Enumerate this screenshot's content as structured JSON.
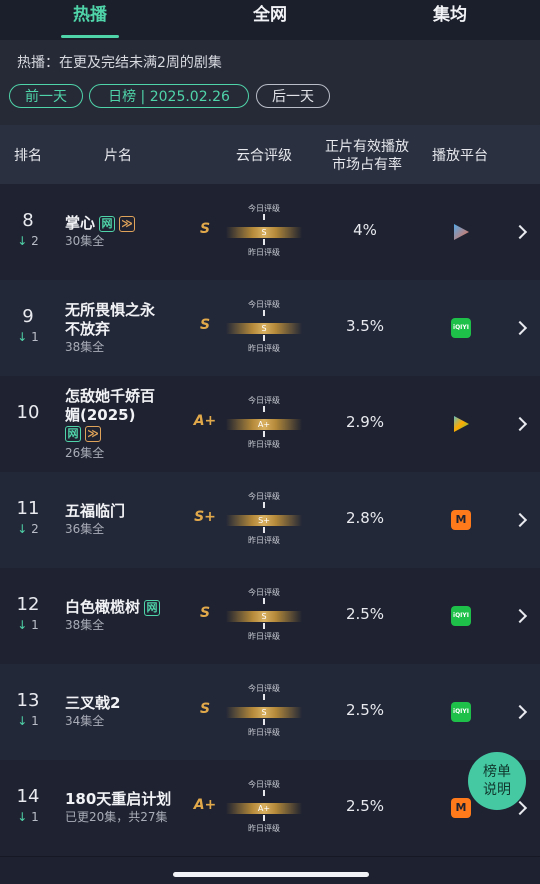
{
  "tabs": [
    "热播",
    "全网",
    "集均"
  ],
  "info": {
    "description": "热播：在更及完结未满2周的剧集",
    "prev_day": "前一天",
    "date_pill": "日榜 | 2025.02.26",
    "next_day": "后一天"
  },
  "header": {
    "rank": "排名",
    "title": "片名",
    "rating": "云合评级",
    "share_l1": "正片有效播放",
    "share_l2": "市场占有率",
    "platform": "播放平台"
  },
  "rating_labels": {
    "today": "今日评级",
    "yesterday": "昨日评级"
  },
  "badges": {
    "net": "网",
    "ff": "≫"
  },
  "rows": [
    {
      "rank": "8",
      "change": "2",
      "title_lines": [
        "掌心"
      ],
      "badges": [
        "net",
        "ff"
      ],
      "episodes": "30集全",
      "grade": "S",
      "share": "4%",
      "platform": "youku-icon"
    },
    {
      "rank": "9",
      "change": "1",
      "title_lines": [
        "无所畏惧之永",
        "不放弃"
      ],
      "badges": [],
      "episodes": "38集全",
      "grade": "S",
      "share": "3.5%",
      "platform": "iqiyi-icon"
    },
    {
      "rank": "10",
      "change": "",
      "title_lines": [
        "怎敌她千娇百",
        "媚(2025)"
      ],
      "badges": [
        "net",
        "ff"
      ],
      "episodes": "26集全",
      "grade": "A+",
      "share": "2.9%",
      "platform": "tencent-video-icon"
    },
    {
      "rank": "11",
      "change": "2",
      "title_lines": [
        "五福临门"
      ],
      "badges": [],
      "episodes": "36集全",
      "grade": "S+",
      "share": "2.8%",
      "platform": "mango-tv-icon"
    },
    {
      "rank": "12",
      "change": "1",
      "title_lines": [
        "白色橄榄树"
      ],
      "badges": [
        "net"
      ],
      "episodes": "38集全",
      "grade": "S",
      "share": "2.5%",
      "platform": "iqiyi-icon"
    },
    {
      "rank": "13",
      "change": "1",
      "title_lines": [
        "三叉戟2"
      ],
      "badges": [],
      "episodes": "34集全",
      "grade": "S",
      "share": "2.5%",
      "platform": "iqiyi-icon"
    },
    {
      "rank": "14",
      "change": "1",
      "title_lines": [
        "180天重启计划"
      ],
      "badges": [],
      "episodes": "已更20集，共27集",
      "grade": "A+",
      "share": "2.5%",
      "platform": "mango-tv-icon"
    }
  ],
  "fab": {
    "line1": "榜单",
    "line2": "说明"
  },
  "colors": {
    "accent": "#4fd3a8",
    "grade": "#e2a94b",
    "background": "#1e2230"
  }
}
